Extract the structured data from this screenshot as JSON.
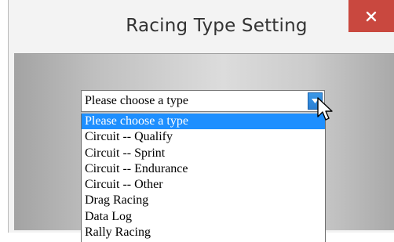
{
  "window": {
    "title": "Racing Type Setting",
    "close_icon": "close-icon"
  },
  "select": {
    "value": "Please choose a type",
    "arrow_icon": "chevron-down-icon",
    "accent_color": "#1e8fff"
  },
  "dropdown": {
    "options": [
      "Please choose a type",
      "Circuit -- Qualify",
      "Circuit -- Sprint",
      "Circuit -- Endurance",
      "Circuit -- Other",
      "Drag Racing",
      "Data Log",
      "Rally Racing"
    ],
    "selected_index": 0
  },
  "cursor": {
    "icon": "mouse-pointer-icon"
  },
  "colors": {
    "close_button": "#c9483f",
    "highlight": "#1e8fff"
  }
}
